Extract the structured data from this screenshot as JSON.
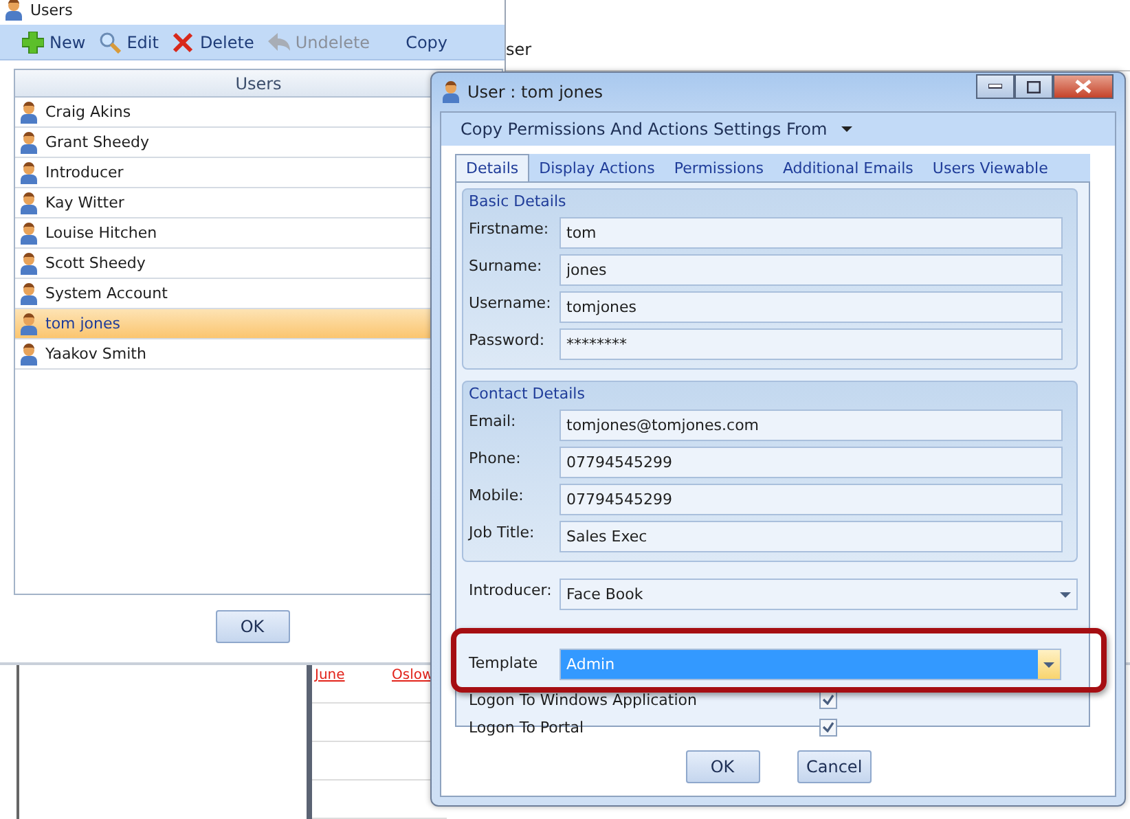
{
  "users_window": {
    "title": "Users",
    "toolbar": [
      {
        "kind": "add",
        "label": "New",
        "disabled": false
      },
      {
        "kind": "edit",
        "label": "Edit",
        "disabled": false
      },
      {
        "kind": "delete",
        "label": "Delete",
        "disabled": false
      },
      {
        "kind": "undo",
        "label": "Undelete",
        "disabled": true
      },
      {
        "kind": "plain",
        "label": "Copy",
        "disabled": false
      }
    ],
    "grid_header": "Users",
    "users": [
      {
        "name": "Craig Akins",
        "selected": false
      },
      {
        "name": "Grant Sheedy",
        "selected": false
      },
      {
        "name": "Introducer",
        "selected": false
      },
      {
        "name": "Kay Witter",
        "selected": false
      },
      {
        "name": "Louise Hitchen",
        "selected": false
      },
      {
        "name": "Scott Sheedy",
        "selected": false
      },
      {
        "name": "System Account",
        "selected": false
      },
      {
        "name": "tom jones",
        "selected": true
      },
      {
        "name": "Yaakov Smith",
        "selected": false
      }
    ],
    "ok_button": "OK"
  },
  "background": {
    "header_text": "ser",
    "links": [
      "June",
      "Oslow"
    ]
  },
  "user_dialog": {
    "title": "User : tom jones",
    "copy_menu": "Copy Permissions And Actions Settings From",
    "tabs": [
      {
        "label": "Details",
        "selected": true
      },
      {
        "label": "Display Actions",
        "selected": false
      },
      {
        "label": "Permissions",
        "selected": false
      },
      {
        "label": "Additional Emails",
        "selected": false
      },
      {
        "label": "Users Viewable",
        "selected": false
      }
    ],
    "groups": [
      {
        "title": "Basic Details",
        "fields": [
          {
            "label": "Firstname:",
            "value": "tom"
          },
          {
            "label": "Surname:",
            "value": "jones"
          },
          {
            "label": "Username:",
            "value": "tomjones"
          },
          {
            "label": "Password:",
            "value": "********"
          }
        ]
      },
      {
        "title": "Contact Details",
        "fields": [
          {
            "label": "Email:",
            "value": "tomjones@tomjones.com"
          },
          {
            "label": "Phone:",
            "value": "07794545299"
          },
          {
            "label": "Mobile:",
            "value": "07794545299"
          },
          {
            "label": "Job Title:",
            "value": "Sales Exec"
          }
        ]
      }
    ],
    "introducer": {
      "label": "Introducer:",
      "value": "Face Book"
    },
    "template": {
      "label": "Template",
      "value": "Admin",
      "highlighted": true
    },
    "checkboxes": [
      {
        "label": "Logon To Windows Application",
        "checked": true
      },
      {
        "label": "Logon To Portal",
        "checked": true
      }
    ],
    "buttons": [
      "OK",
      "Cancel"
    ]
  }
}
